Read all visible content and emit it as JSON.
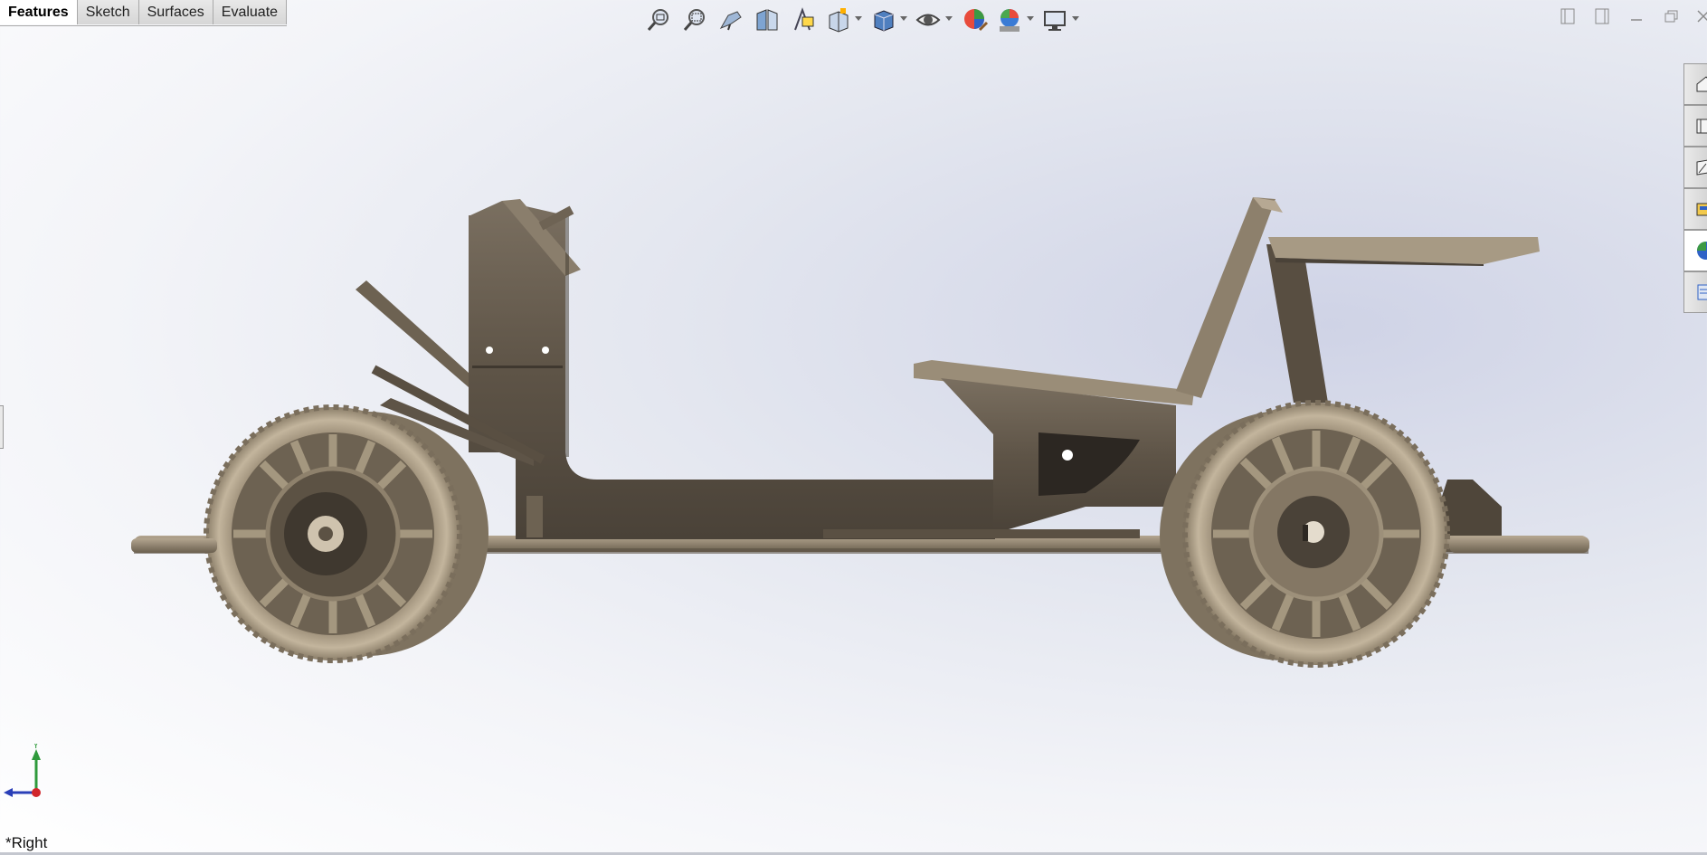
{
  "tabs": [
    {
      "label": "Features",
      "active": true
    },
    {
      "label": "Sketch",
      "active": false
    },
    {
      "label": "Surfaces",
      "active": false
    },
    {
      "label": "Evaluate",
      "active": false
    }
  ],
  "heads_up_toolbar": [
    "zoom-to-fit-icon",
    "zoom-to-area-icon",
    "previous-view-icon",
    "section-view-icon",
    "dynamic-annotation-views-icon",
    "view-orientation-icon",
    "display-style-icon",
    "hide-show-items-icon",
    "edit-appearance-icon",
    "apply-scene-icon",
    "view-settings-icon"
  ],
  "task_pane": [
    "home-icon",
    "resources-icon",
    "design-library-icon",
    "file-explorer-icon",
    "appearances-scenes-icon",
    "custom-properties-icon"
  ],
  "triad": {
    "y_label": "Y"
  },
  "view": {
    "name": "*Right"
  },
  "colors": {
    "model_metal": "#5e5447",
    "tire": "#b3a58f",
    "background_tint": "#cfd3e6"
  }
}
